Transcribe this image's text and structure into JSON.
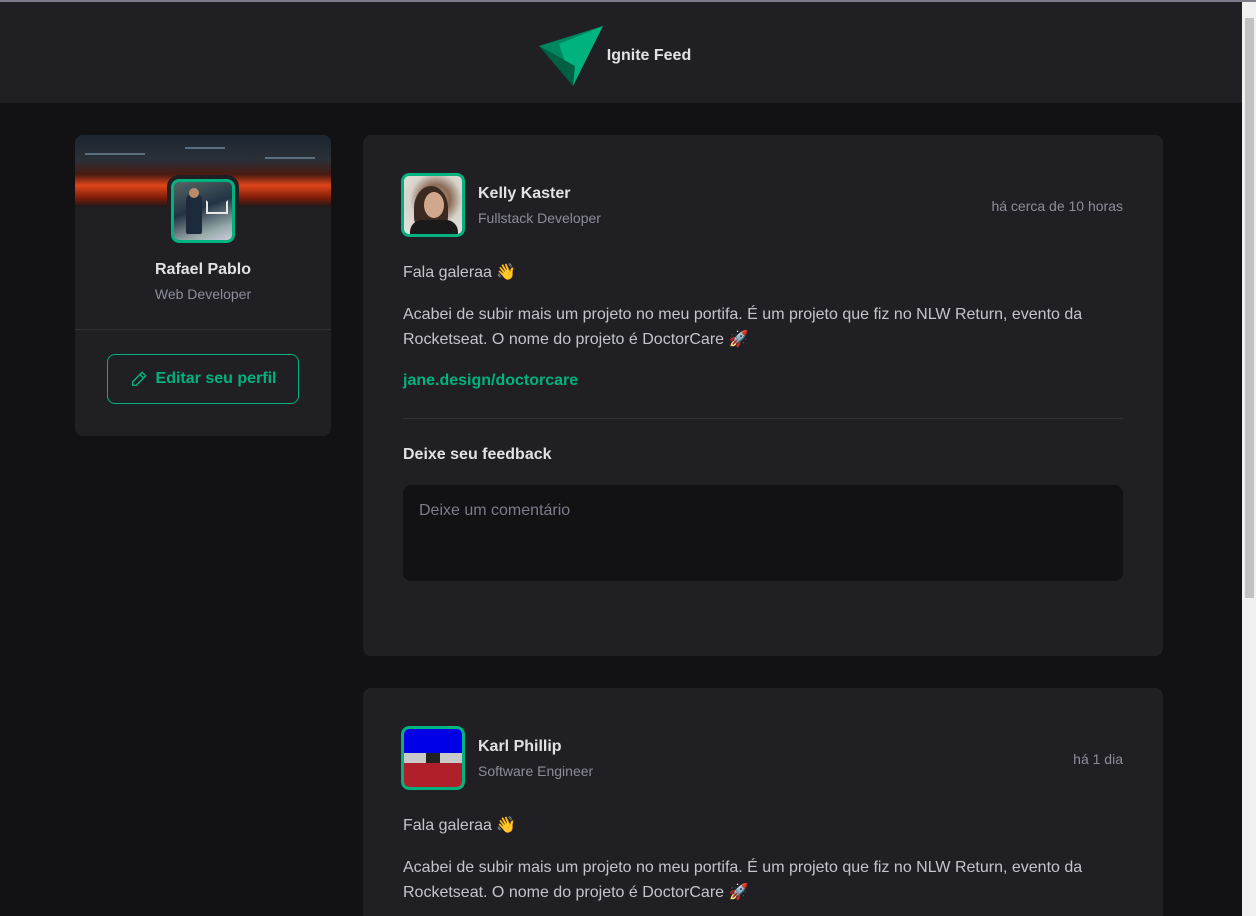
{
  "header": {
    "app_name": "Ignite Feed",
    "logo_icon": "ignite-logo-icon",
    "accent": "#00b37e"
  },
  "sidebar": {
    "name": "Rafael Pablo",
    "role": "Web Developer",
    "edit_button_label": "Editar seu perfil",
    "edit_icon": "pencil-icon"
  },
  "posts": [
    {
      "author": {
        "name": "Kelly Kaster",
        "role": "Fullstack Developer"
      },
      "time": "há cerca de 10 horas",
      "greeting": "Fala galeraa 👋",
      "content": "Acabei de subir mais um projeto no meu portifa. É um projeto que fiz no NLW Return, evento da Rocketseat. O nome do projeto é DoctorCare 🚀",
      "link": "jane.design/doctorcare",
      "feedback_title": "Deixe seu feedback",
      "comment_placeholder": "Deixe um comentário"
    },
    {
      "author": {
        "name": "Karl Phillip",
        "role": "Software Engineer"
      },
      "time": "há 1 dia",
      "greeting": "Fala galeraa 👋",
      "content": "Acabei de subir mais um projeto no meu portifa. É um projeto que fiz no NLW Return, evento da Rocketseat. O nome do projeto é DoctorCare 🚀"
    }
  ]
}
